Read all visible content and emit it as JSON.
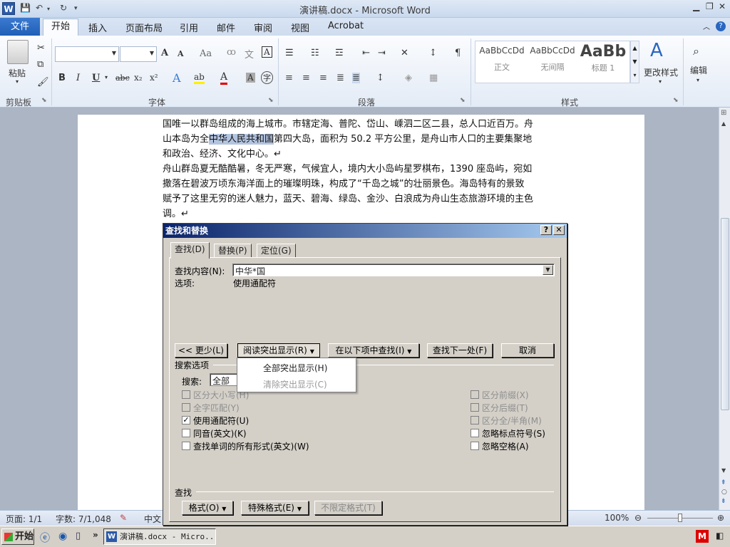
{
  "window": {
    "title": "演讲稿.docx - Microsoft Word",
    "app_letter": "W"
  },
  "tabs": {
    "file": "文件",
    "items": [
      "开始",
      "插入",
      "页面布局",
      "引用",
      "邮件",
      "审阅",
      "视图",
      "Acrobat"
    ]
  },
  "ribbon": {
    "clipboard": {
      "paste": "粘贴",
      "label": "剪贴板"
    },
    "font": {
      "label": "字体",
      "font_name": "",
      "font_size": "",
      "grow": "A",
      "shrink": "A",
      "change_case": "Aa",
      "bold": "B",
      "italic": "I",
      "underline": "U",
      "strike": "abc",
      "subscript": "x₂",
      "superscript": "x²",
      "text_effect": "A",
      "highlight": "ab",
      "font_color": "A",
      "char_shading": "A",
      "enclose": "字"
    },
    "paragraph": {
      "label": "段落"
    },
    "styles": {
      "label": "样式",
      "items": [
        {
          "preview": "AaBbCcDd",
          "name": "正文"
        },
        {
          "preview": "AaBbCcDd",
          "name": "无间隔"
        },
        {
          "preview": "AaBb",
          "name": "标题 1"
        }
      ],
      "change_styles": "更改样式"
    },
    "editing": {
      "label": "编辑"
    }
  },
  "document": {
    "lines": [
      {
        "text": "国唯一以群岛组成的海上城市。市辖定海、普陀、岱山、嵊泗二区二县，总人口近百万。舟"
      },
      {
        "pre": "山本岛为全",
        "highlight": "中华人民共和国",
        "post": "第四大岛，面积为 50.2 平方公里，是舟山市人口的主要集聚地"
      },
      {
        "text": "和政治、经济、文化中心。↵"
      },
      {
        "text": "舟山群岛夏无酷酷暑，冬无严寒，气候宜人，境内大小岛屿星罗棋布，1390 座岛屿，宛如"
      },
      {
        "text": "撒落在碧波万顷东海洋面上的璀璨明珠，构成了“千岛之城”的壮丽景色。海岛特有的景致"
      },
      {
        "text": "赋予了这里无穷的迷人魅力，蓝天、碧海、绿岛、金沙、白浪成为舟山生态旅游环境的主色"
      },
      {
        "text": "调。↵"
      }
    ]
  },
  "dialog": {
    "title": "查找和替换",
    "help": "?",
    "close": "✕",
    "tabs": [
      "查找(D)",
      "替换(P)",
      "定位(G)"
    ],
    "find_label": "查找内容(N):",
    "find_value": "中华*国",
    "options_label": "选项:",
    "options_value": "使用通配符",
    "buttons": {
      "less": "<< 更少(L)",
      "reading_highlight": "阅读突出显示(R)",
      "find_in": "在以下项中查找(I)",
      "find_next": "查找下一处(F)",
      "cancel": "取消"
    },
    "popup": {
      "highlight_all": "全部突出显示(H)",
      "clear_highlight": "清除突出显示(C)"
    },
    "search_options_label": "搜索选项",
    "search_label": "搜索:",
    "search_value": "全部",
    "left_checks": [
      {
        "label": "区分大小写(H)",
        "checked": false,
        "disabled": true
      },
      {
        "label": "全字匹配(Y)",
        "checked": false,
        "disabled": true
      },
      {
        "label": "使用通配符(U)",
        "checked": true,
        "disabled": false
      },
      {
        "label": "同音(英文)(K)",
        "checked": false,
        "disabled": false
      },
      {
        "label": "查找单词的所有形式(英文)(W)",
        "checked": false,
        "disabled": false
      }
    ],
    "right_checks": [
      {
        "label": "区分前缀(X)",
        "checked": false,
        "disabled": true
      },
      {
        "label": "区分后缀(T)",
        "checked": false,
        "disabled": true
      },
      {
        "label": "区分全/半角(M)",
        "checked": false,
        "disabled": true
      },
      {
        "label": "忽略标点符号(S)",
        "checked": false,
        "disabled": false
      },
      {
        "label": "忽略空格(A)",
        "checked": false,
        "disabled": false
      }
    ],
    "find_section_label": "查找",
    "format_button": "格式(O)",
    "special_button": "特殊格式(E)",
    "no_format_button": "不限定格式(T)"
  },
  "status": {
    "page": "页面: 1/1",
    "words": "字数: 7/1,048",
    "lang": "中文",
    "zoom": "100%",
    "zoom_fraction": 0.5
  },
  "taskbar": {
    "start": "开始",
    "task": "演讲稿.docx - Micro..."
  },
  "colors": {
    "title_gradient_start": "#0a246a",
    "file_tab": "#2a66c0",
    "highlight": "#b3c4e0"
  }
}
